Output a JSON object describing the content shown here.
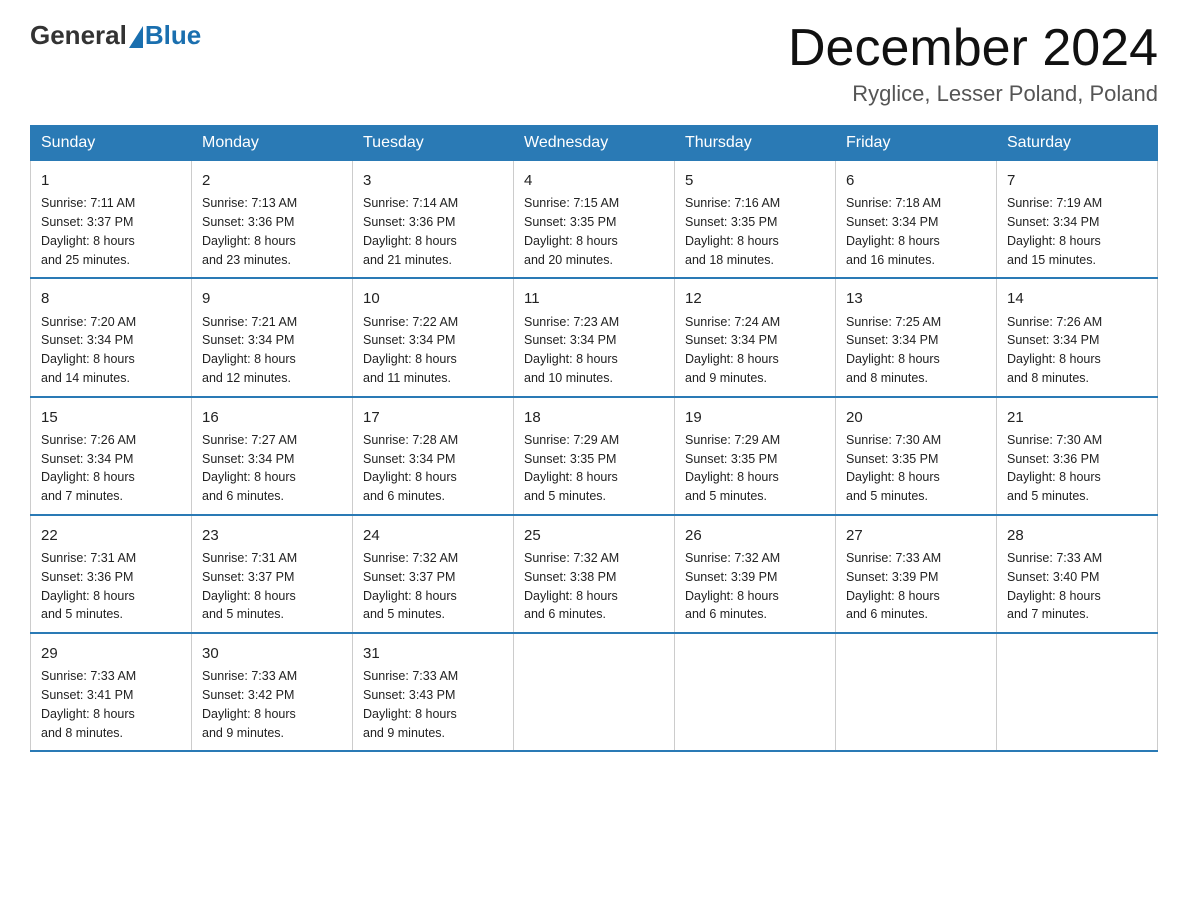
{
  "header": {
    "logo_text_general": "General",
    "logo_text_blue": "Blue",
    "month_title": "December 2024",
    "location": "Ryglice, Lesser Poland, Poland"
  },
  "days_of_week": [
    "Sunday",
    "Monday",
    "Tuesday",
    "Wednesday",
    "Thursday",
    "Friday",
    "Saturday"
  ],
  "weeks": [
    [
      {
        "day": "1",
        "sunrise": "7:11 AM",
        "sunset": "3:37 PM",
        "daylight": "8 hours and 25 minutes."
      },
      {
        "day": "2",
        "sunrise": "7:13 AM",
        "sunset": "3:36 PM",
        "daylight": "8 hours and 23 minutes."
      },
      {
        "day": "3",
        "sunrise": "7:14 AM",
        "sunset": "3:36 PM",
        "daylight": "8 hours and 21 minutes."
      },
      {
        "day": "4",
        "sunrise": "7:15 AM",
        "sunset": "3:35 PM",
        "daylight": "8 hours and 20 minutes."
      },
      {
        "day": "5",
        "sunrise": "7:16 AM",
        "sunset": "3:35 PM",
        "daylight": "8 hours and 18 minutes."
      },
      {
        "day": "6",
        "sunrise": "7:18 AM",
        "sunset": "3:34 PM",
        "daylight": "8 hours and 16 minutes."
      },
      {
        "day": "7",
        "sunrise": "7:19 AM",
        "sunset": "3:34 PM",
        "daylight": "8 hours and 15 minutes."
      }
    ],
    [
      {
        "day": "8",
        "sunrise": "7:20 AM",
        "sunset": "3:34 PM",
        "daylight": "8 hours and 14 minutes."
      },
      {
        "day": "9",
        "sunrise": "7:21 AM",
        "sunset": "3:34 PM",
        "daylight": "8 hours and 12 minutes."
      },
      {
        "day": "10",
        "sunrise": "7:22 AM",
        "sunset": "3:34 PM",
        "daylight": "8 hours and 11 minutes."
      },
      {
        "day": "11",
        "sunrise": "7:23 AM",
        "sunset": "3:34 PM",
        "daylight": "8 hours and 10 minutes."
      },
      {
        "day": "12",
        "sunrise": "7:24 AM",
        "sunset": "3:34 PM",
        "daylight": "8 hours and 9 minutes."
      },
      {
        "day": "13",
        "sunrise": "7:25 AM",
        "sunset": "3:34 PM",
        "daylight": "8 hours and 8 minutes."
      },
      {
        "day": "14",
        "sunrise": "7:26 AM",
        "sunset": "3:34 PM",
        "daylight": "8 hours and 8 minutes."
      }
    ],
    [
      {
        "day": "15",
        "sunrise": "7:26 AM",
        "sunset": "3:34 PM",
        "daylight": "8 hours and 7 minutes."
      },
      {
        "day": "16",
        "sunrise": "7:27 AM",
        "sunset": "3:34 PM",
        "daylight": "8 hours and 6 minutes."
      },
      {
        "day": "17",
        "sunrise": "7:28 AM",
        "sunset": "3:34 PM",
        "daylight": "8 hours and 6 minutes."
      },
      {
        "day": "18",
        "sunrise": "7:29 AM",
        "sunset": "3:35 PM",
        "daylight": "8 hours and 5 minutes."
      },
      {
        "day": "19",
        "sunrise": "7:29 AM",
        "sunset": "3:35 PM",
        "daylight": "8 hours and 5 minutes."
      },
      {
        "day": "20",
        "sunrise": "7:30 AM",
        "sunset": "3:35 PM",
        "daylight": "8 hours and 5 minutes."
      },
      {
        "day": "21",
        "sunrise": "7:30 AM",
        "sunset": "3:36 PM",
        "daylight": "8 hours and 5 minutes."
      }
    ],
    [
      {
        "day": "22",
        "sunrise": "7:31 AM",
        "sunset": "3:36 PM",
        "daylight": "8 hours and 5 minutes."
      },
      {
        "day": "23",
        "sunrise": "7:31 AM",
        "sunset": "3:37 PM",
        "daylight": "8 hours and 5 minutes."
      },
      {
        "day": "24",
        "sunrise": "7:32 AM",
        "sunset": "3:37 PM",
        "daylight": "8 hours and 5 minutes."
      },
      {
        "day": "25",
        "sunrise": "7:32 AM",
        "sunset": "3:38 PM",
        "daylight": "8 hours and 6 minutes."
      },
      {
        "day": "26",
        "sunrise": "7:32 AM",
        "sunset": "3:39 PM",
        "daylight": "8 hours and 6 minutes."
      },
      {
        "day": "27",
        "sunrise": "7:33 AM",
        "sunset": "3:39 PM",
        "daylight": "8 hours and 6 minutes."
      },
      {
        "day": "28",
        "sunrise": "7:33 AM",
        "sunset": "3:40 PM",
        "daylight": "8 hours and 7 minutes."
      }
    ],
    [
      {
        "day": "29",
        "sunrise": "7:33 AM",
        "sunset": "3:41 PM",
        "daylight": "8 hours and 8 minutes."
      },
      {
        "day": "30",
        "sunrise": "7:33 AM",
        "sunset": "3:42 PM",
        "daylight": "8 hours and 9 minutes."
      },
      {
        "day": "31",
        "sunrise": "7:33 AM",
        "sunset": "3:43 PM",
        "daylight": "8 hours and 9 minutes."
      },
      null,
      null,
      null,
      null
    ]
  ],
  "labels": {
    "sunrise": "Sunrise:",
    "sunset": "Sunset:",
    "daylight": "Daylight:"
  }
}
